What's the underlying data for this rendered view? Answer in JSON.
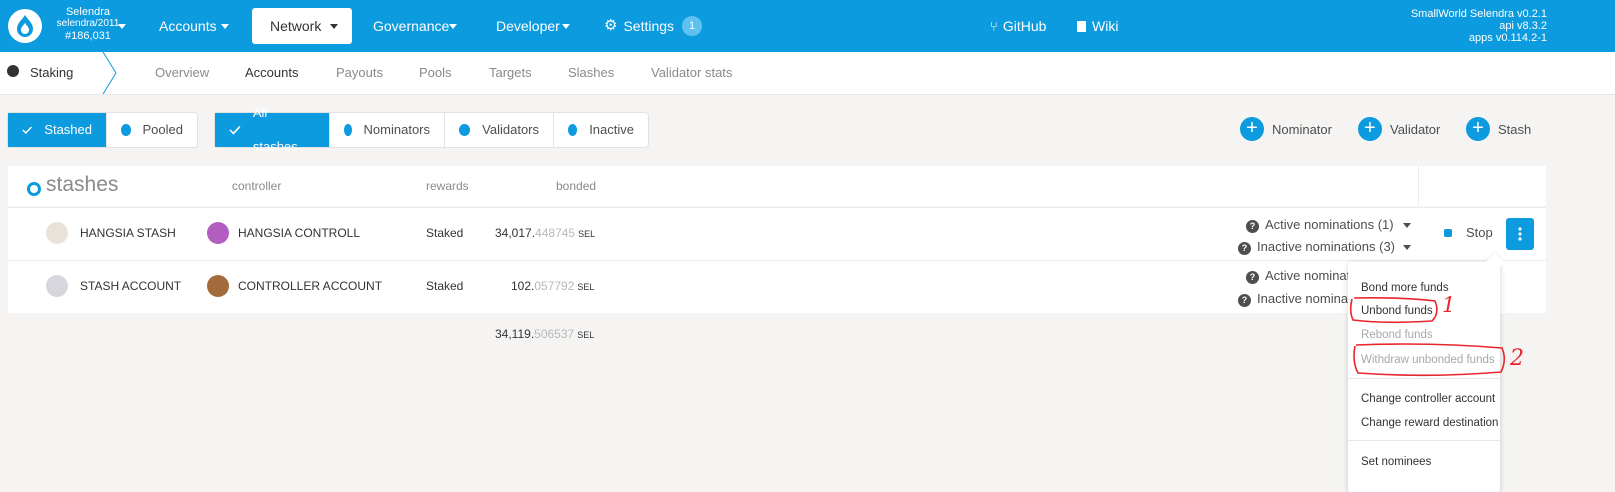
{
  "header": {
    "chain_name": "Selendra",
    "chain_spec": "selendra/2011",
    "block": "#186,031",
    "nav": [
      {
        "label": "Accounts"
      },
      {
        "label": "Network"
      },
      {
        "label": "Governance"
      },
      {
        "label": "Developer"
      },
      {
        "label": "Settings"
      }
    ],
    "settings_badge": "1",
    "links": {
      "github": "GitHub",
      "wiki": "Wiki"
    },
    "version": {
      "line1": "SmallWorld Selendra v0.2.1",
      "line2": "api v8.3.2",
      "line3": "apps v0.114.2-1"
    },
    "colors": {
      "accent": "#0b9bde"
    }
  },
  "subnav": {
    "section": "Staking",
    "tabs": [
      "Overview",
      "Accounts",
      "Payouts",
      "Pools",
      "Targets",
      "Slashes",
      "Validator stats"
    ],
    "active_tab": "Accounts"
  },
  "filters": {
    "group1": [
      "Stashed",
      "Pooled"
    ],
    "group2": [
      "All stashes",
      "Nominators",
      "Validators",
      "Inactive"
    ]
  },
  "actions": [
    "Nominator",
    "Validator",
    "Stash"
  ],
  "table": {
    "title": "stashes",
    "columns": [
      "controller",
      "rewards",
      "bonded"
    ],
    "rows": [
      {
        "stash": "HANGSIA STASH",
        "controller": "HANGSIA CONTROLL",
        "rewards": "Staked",
        "bonded_int": "34,017.",
        "bonded_dec": "448745",
        "unit": "SEL",
        "active_nom": "Active nominations (1)",
        "inactive_nom": "Inactive nominations (3)",
        "stop": "Stop"
      },
      {
        "stash": "STASH ACCOUNT",
        "controller": "CONTROLLER ACCOUNT",
        "rewards": "Staked",
        "bonded_int": "102.",
        "bonded_dec": "057792",
        "unit": "SEL",
        "active_nom": "Active nominati",
        "inactive_nom": "Inactive nominati"
      }
    ],
    "total": {
      "int": "34,119.",
      "dec": "506537",
      "unit": "SEL"
    }
  },
  "menu": {
    "items": [
      {
        "label": "Bond more funds",
        "enabled": true
      },
      {
        "label": "Unbond funds",
        "enabled": true
      },
      {
        "label": "Rebond funds",
        "enabled": false
      },
      {
        "label": "Withdraw unbonded funds",
        "enabled": false
      },
      {
        "label": "Change controller account",
        "enabled": true
      },
      {
        "label": "Change reward destination",
        "enabled": true
      },
      {
        "label": "Set nominees",
        "enabled": true
      }
    ]
  },
  "annotations": {
    "mark1": "1",
    "mark2": "2",
    "color": "#e8262b"
  }
}
